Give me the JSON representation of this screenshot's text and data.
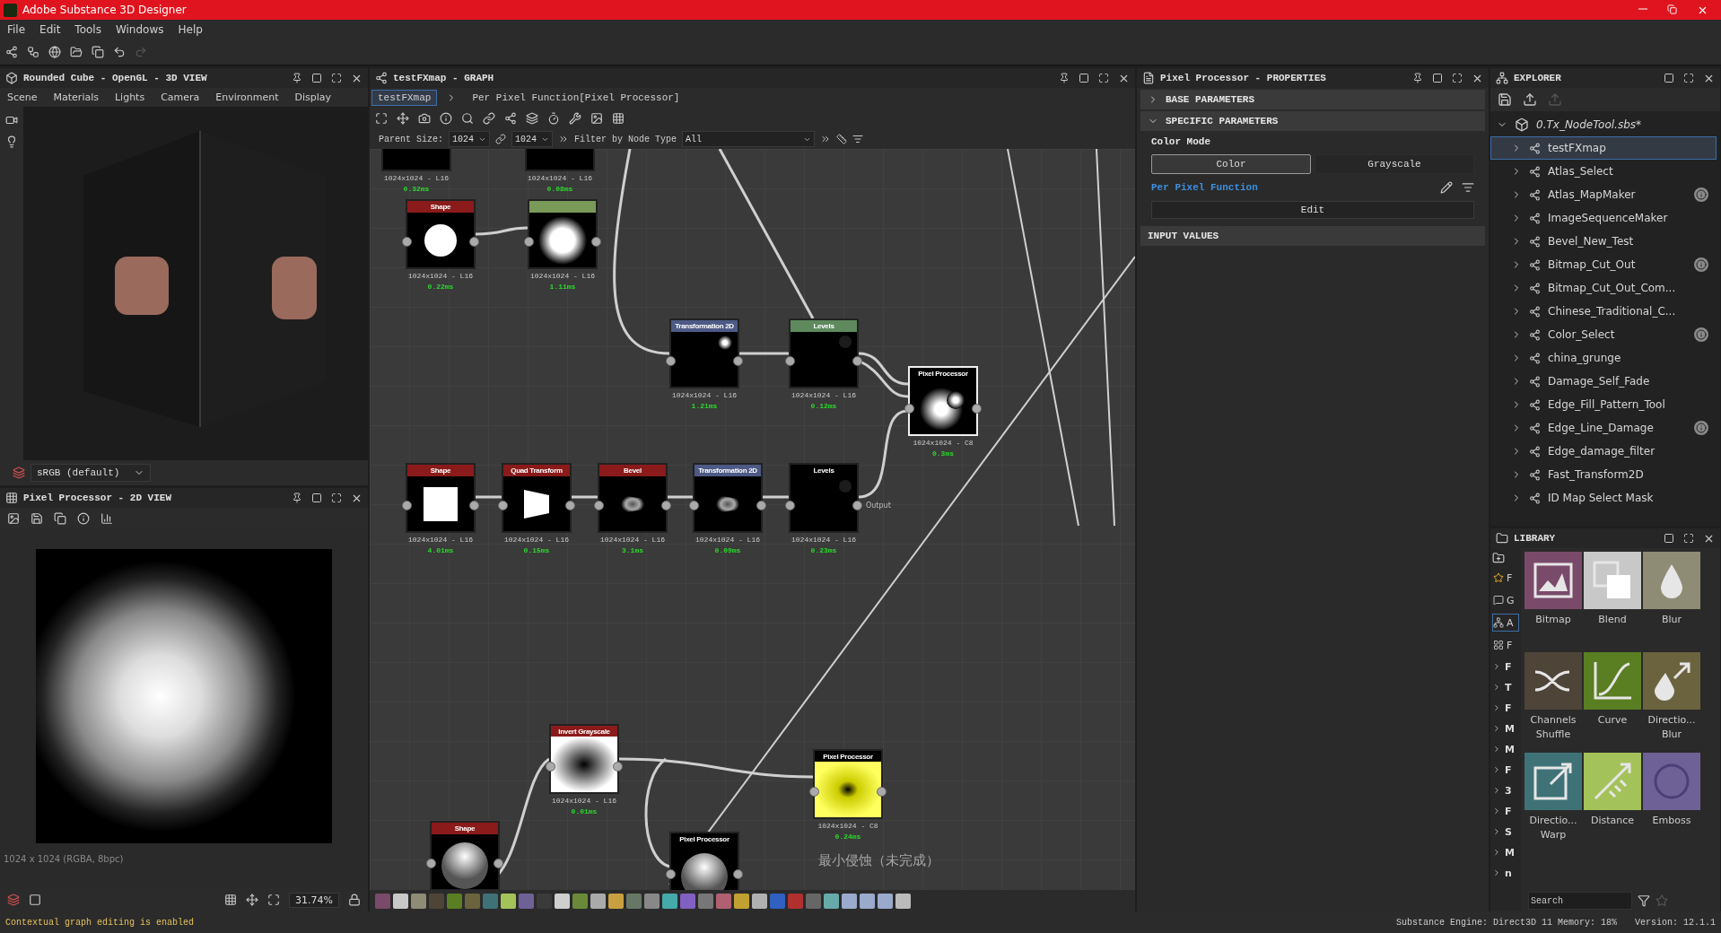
{
  "window": {
    "title": "Adobe Substance 3D Designer"
  },
  "menu": [
    "File",
    "Edit",
    "Tools",
    "Windows",
    "Help"
  ],
  "view3d": {
    "title": "Rounded Cube - OpenGL - 3D VIEW",
    "tabs": [
      "Scene",
      "Materials",
      "Lights",
      "Camera",
      "Environment",
      "Display"
    ],
    "colorspace": "sRGB (default)"
  },
  "view2d": {
    "title": "Pixel Processor - 2D VIEW",
    "info": "1024 x 1024 (RGBA, 8bpc)",
    "zoom": "31.74%"
  },
  "graph": {
    "title": "testFXmap - GRAPH",
    "breadcrumb": [
      {
        "label": "testFXmap",
        "selected": true
      },
      {
        "label": "Per Pixel Function[Pixel Processor]",
        "selected": false
      }
    ],
    "parent_size_label": "Parent Size:",
    "parent_size": "1024",
    "size_2": "1024",
    "filter_label": "Filter by Node Type",
    "filter": "All",
    "nodes": [
      {
        "kind": "dark",
        "color": "#000000",
        "info": "1024x1024 - L16",
        "time": "0.32ms",
        "selected": false
      },
      {
        "kind": "dark",
        "color": "#000000",
        "info": "1024x1024 - L16",
        "time": "0.08ms",
        "selected": false
      },
      {
        "kind": "circle",
        "title": "Shape",
        "color": "#8b1a1a",
        "info": "1024x1024 - L16",
        "time": "0.22ms",
        "selected": false
      },
      {
        "kind": "glow",
        "color": "#7a9a5a",
        "info": "1024x1024 - L16",
        "time": "1.11ms",
        "selected": false
      },
      {
        "kind": "dot",
        "title": "Transformation 2D",
        "color": "#4d5a85",
        "info": "1024x1024 - L16",
        "time": "1.21ms",
        "selected": false
      },
      {
        "kind": "faint",
        "title": "Levels",
        "color": "#5e8a5e",
        "info": "1024x1024 - L16",
        "time": "0.12ms",
        "selected": false
      },
      {
        "kind": "blob",
        "title": "Pixel Processor",
        "color": "#000000",
        "info": "1024x1024 - C8",
        "time": "0.3ms",
        "selected": true
      },
      {
        "kind": "square",
        "title": "Shape",
        "color": "#8b1a1a",
        "info": "1024x1024 - L16",
        "time": "4.01ms",
        "selected": false
      },
      {
        "kind": "quad",
        "title": "Quad Transform",
        "color": "#8b1a1a",
        "info": "1024x1024 - L16",
        "time": "0.15ms",
        "selected": false
      },
      {
        "kind": "bevel",
        "title": "Bevel",
        "color": "#8b1a1a",
        "info": "1024x1024 - L16",
        "time": "3.1ms",
        "selected": false
      },
      {
        "kind": "bevel",
        "title": "Transformation 2D",
        "color": "#4d5a85",
        "info": "1024x1024 - L16",
        "time": "0.09ms",
        "selected": false
      },
      {
        "kind": "faint",
        "title": "Levels",
        "color": "#000000",
        "info": "1024x1024 - L16",
        "time": "0.23ms",
        "selected": false
      },
      {
        "kind": "hole",
        "title": "Invert Grayscale",
        "color": "#8b1a1a",
        "info": "1024x1024 - L16",
        "time": "0.01ms",
        "selected": false
      },
      {
        "kind": "yellow",
        "title": "Pixel Processor",
        "color": "#000000",
        "info": "1024x1024 - C8",
        "time": "0.24ms",
        "selected": false
      },
      {
        "kind": "sphere",
        "title": "Shape",
        "color": "#8b1a1a",
        "selected": false
      },
      {
        "kind": "sphere",
        "title": "Pixel Processor",
        "color": "#000000",
        "selected": false
      }
    ],
    "output_label": "Output",
    "frame_caption": "最小侵蚀（未完成）"
  },
  "properties": {
    "title": "Pixel Processor - PROPERTIES",
    "sections": [
      {
        "label": "BASE PARAMETERS",
        "expanded": false
      },
      {
        "label": "SPECIFIC PARAMETERS",
        "expanded": true
      }
    ],
    "color_mode_label": "Color Mode",
    "color_modes": [
      {
        "label": "Color",
        "selected": true
      },
      {
        "label": "Grayscale",
        "selected": false
      }
    ],
    "function_label": "Per Pixel Function",
    "edit_button": "Edit",
    "input_values": "INPUT VALUES"
  },
  "explorer": {
    "title": "EXPLORER",
    "package": "0.Tx_NodeTool.sbs*",
    "items": [
      {
        "label": "testFXmap",
        "selected": true,
        "info": false
      },
      {
        "label": "Atlas_Select",
        "selected": false,
        "info": false
      },
      {
        "label": "Atlas_MapMaker",
        "selected": false,
        "info": true
      },
      {
        "label": "ImageSequenceMaker",
        "selected": false,
        "info": false
      },
      {
        "label": "Bevel_New_Test",
        "selected": false,
        "info": false
      },
      {
        "label": "Bitmap_Cut_Out",
        "selected": false,
        "info": true
      },
      {
        "label": "Bitmap_Cut_Out_Com...",
        "selected": false,
        "info": false
      },
      {
        "label": "Chinese_Traditional_C...",
        "selected": false,
        "info": false
      },
      {
        "label": "Color_Select",
        "selected": false,
        "info": true
      },
      {
        "label": "china_grunge",
        "selected": false,
        "info": false
      },
      {
        "label": "Damage_Self_Fade",
        "selected": false,
        "info": false
      },
      {
        "label": "Edge_Fill_Pattern_Tool",
        "selected": false,
        "info": false
      },
      {
        "label": "Edge_Line_Damage",
        "selected": false,
        "info": true
      },
      {
        "label": "Edge_damage_filter",
        "selected": false,
        "info": false
      },
      {
        "label": "Fast_Transform2D",
        "selected": false,
        "info": false
      },
      {
        "label": "ID Map Select Mask",
        "selected": false,
        "info": false
      }
    ]
  },
  "library": {
    "title": "LIBRARY",
    "categories": [
      {
        "kind": "star",
        "label": "F",
        "selected": false
      },
      {
        "kind": "comment",
        "label": "G",
        "selected": false
      },
      {
        "kind": "graph",
        "label": "A",
        "selected": true
      },
      {
        "kind": "grid",
        "label": "F",
        "selected": false
      }
    ],
    "tree": [
      "F",
      "T",
      "F",
      "M",
      "M",
      "F",
      "3",
      "F",
      "S",
      "M",
      "n"
    ],
    "tiles": [
      {
        "kind": "bitmap",
        "label": "Bitmap",
        "color": "#7a4a6a"
      },
      {
        "kind": "blend",
        "label": "Blend",
        "color": "#c8c8c8"
      },
      {
        "kind": "blur",
        "label": "Blur",
        "color": "#8e8c74"
      },
      {
        "kind": "shuffle",
        "label": "Channels Shuffle",
        "color": "#4e4438"
      },
      {
        "kind": "curve",
        "label": "Curve",
        "color": "#5a7e22"
      },
      {
        "kind": "dirblur",
        "label": "Directio... Blur",
        "color": "#6b633e"
      },
      {
        "kind": "warp",
        "label": "Directio... Warp",
        "color": "#3f7276"
      },
      {
        "kind": "distance",
        "label": "Distance",
        "color": "#a4c25a"
      },
      {
        "kind": "emboss",
        "label": "Emboss",
        "color": "#6e6196"
      }
    ],
    "search_placeholder": "Search"
  },
  "status_bar": {
    "message": "Contextual graph editing is enabled",
    "engine": "Substance Engine: Direct3D 11 Memory: 18%",
    "version": "Version: 12.1.1"
  }
}
